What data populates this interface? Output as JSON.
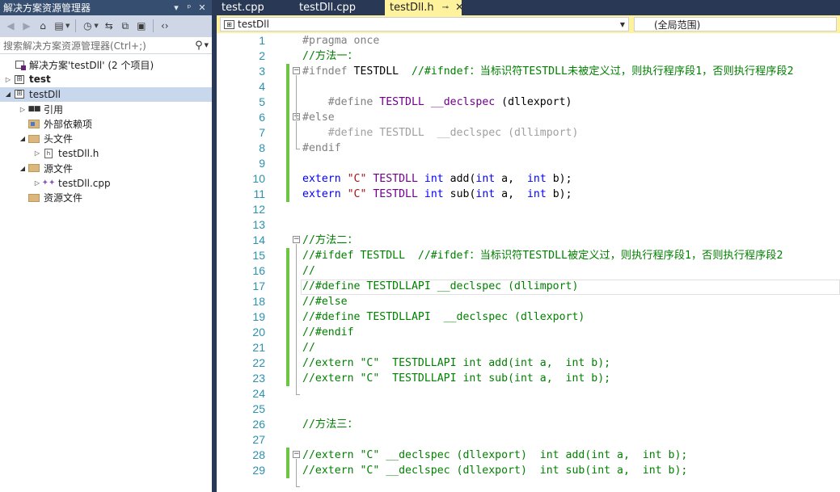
{
  "solution_explorer": {
    "title": "解决方案资源管理器",
    "title_controls": [
      "▾",
      "ᵖ",
      "✕"
    ],
    "search_placeholder": "搜索解决方案资源管理器(Ctrl+;)",
    "tree": [
      {
        "label": "解决方案'testDll' (2 个项目)",
        "icon": "solution-icon",
        "level": 0,
        "expander": "",
        "bold": false,
        "selected": false
      },
      {
        "label": "test",
        "icon": "project-icon",
        "level": 0,
        "expander": "▷",
        "bold": true,
        "selected": false
      },
      {
        "label": "testDll",
        "icon": "project-icon",
        "level": 0,
        "expander": "◢",
        "bold": false,
        "selected": true
      },
      {
        "label": "引用",
        "icon": "references-icon",
        "level": 1,
        "expander": "▷",
        "bold": false,
        "selected": false
      },
      {
        "label": "外部依赖项",
        "icon": "external-dependencies-icon",
        "level": 1,
        "expander": "",
        "bold": false,
        "selected": false
      },
      {
        "label": "头文件",
        "icon": "folder-icon",
        "level": 1,
        "expander": "◢",
        "bold": false,
        "selected": false
      },
      {
        "label": "testDll.h",
        "icon": "header-file-icon",
        "level": 2,
        "expander": "▷",
        "bold": false,
        "selected": false
      },
      {
        "label": "源文件",
        "icon": "folder-icon",
        "level": 1,
        "expander": "◢",
        "bold": false,
        "selected": false
      },
      {
        "label": "testDll.cpp",
        "icon": "cpp-file-icon",
        "level": 2,
        "expander": "▷",
        "bold": false,
        "selected": false
      },
      {
        "label": "资源文件",
        "icon": "folder-icon",
        "level": 1,
        "expander": "",
        "bold": false,
        "selected": false
      }
    ]
  },
  "editor": {
    "tabs": [
      {
        "label": "test.cpp",
        "active": false
      },
      {
        "label": "testDll.cpp",
        "active": false
      },
      {
        "label": "testDll.h",
        "active": true,
        "pin": "⊸",
        "close": "✕"
      }
    ],
    "nav_left": "testDll",
    "nav_right": "(全局范围)",
    "lines": [
      {
        "n": "1",
        "segs": [
          [
            "pp",
            "#pragma once"
          ]
        ]
      },
      {
        "n": "2",
        "segs": [
          [
            "cm",
            "//方法一："
          ]
        ]
      },
      {
        "n": "3",
        "segs": [
          [
            "pp",
            "#ifndef "
          ],
          [
            "pl",
            "TESTDLL  "
          ],
          [
            "cm",
            "//#ifndef：当标识符TESTDLL未被定义过，则执行程序段1，否则执行程序段2"
          ]
        ]
      },
      {
        "n": "4",
        "segs": []
      },
      {
        "n": "5",
        "segs": [
          [
            "pp",
            "    #define "
          ],
          [
            "mac",
            "TESTDLL "
          ],
          [
            "mac",
            "__declspec"
          ],
          [
            "pl",
            " (dllexport)"
          ]
        ]
      },
      {
        "n": "6",
        "segs": [
          [
            "pp",
            "#else"
          ]
        ]
      },
      {
        "n": "7",
        "segs": [
          [
            "dim",
            "    #define TESTDLL  __declspec (dllimport)"
          ]
        ]
      },
      {
        "n": "8",
        "segs": [
          [
            "pp",
            "#endif"
          ]
        ]
      },
      {
        "n": "9",
        "segs": []
      },
      {
        "n": "10",
        "segs": [
          [
            "kw",
            "extern "
          ],
          [
            "str",
            "\"C\" "
          ],
          [
            "mac",
            "TESTDLL "
          ],
          [
            "kw",
            "int "
          ],
          [
            "pl",
            "add("
          ],
          [
            "kw",
            "int "
          ],
          [
            "pl",
            "a,  "
          ],
          [
            "kw",
            "int "
          ],
          [
            "pl",
            "b);"
          ]
        ]
      },
      {
        "n": "11",
        "segs": [
          [
            "kw",
            "extern "
          ],
          [
            "str",
            "\"C\" "
          ],
          [
            "mac",
            "TESTDLL "
          ],
          [
            "kw",
            "int "
          ],
          [
            "pl",
            "sub("
          ],
          [
            "kw",
            "int "
          ],
          [
            "pl",
            "a,  "
          ],
          [
            "kw",
            "int "
          ],
          [
            "pl",
            "b);"
          ]
        ]
      },
      {
        "n": "12",
        "segs": []
      },
      {
        "n": "13",
        "segs": []
      },
      {
        "n": "14",
        "segs": [
          [
            "cm",
            "//方法二："
          ]
        ]
      },
      {
        "n": "15",
        "segs": [
          [
            "cm",
            "//#ifdef TESTDLL  //#ifdef：当标识符TESTDLL被定义过，则执行程序段1，否则执行程序段2"
          ]
        ]
      },
      {
        "n": "16",
        "segs": [
          [
            "cm",
            "//"
          ]
        ]
      },
      {
        "n": "17",
        "segs": [
          [
            "cm",
            "//#define TESTDLLAPI __declspec (dllimport)"
          ]
        ]
      },
      {
        "n": "18",
        "segs": [
          [
            "cm",
            "//#else"
          ]
        ]
      },
      {
        "n": "19",
        "segs": [
          [
            "cm",
            "//#define TESTDLLAPI  __declspec (dllexport)"
          ]
        ]
      },
      {
        "n": "20",
        "segs": [
          [
            "cm",
            "//#endif"
          ]
        ]
      },
      {
        "n": "21",
        "segs": [
          [
            "cm",
            "//"
          ]
        ]
      },
      {
        "n": "22",
        "segs": [
          [
            "cm",
            "//extern \"C\"  TESTDLLAPI int add(int a,  int b);"
          ]
        ]
      },
      {
        "n": "23",
        "segs": [
          [
            "cm",
            "//extern \"C\"  TESTDLLAPI int sub(int a,  int b);"
          ]
        ]
      },
      {
        "n": "24",
        "segs": []
      },
      {
        "n": "25",
        "segs": []
      },
      {
        "n": "26",
        "segs": [
          [
            "cm",
            "//方法三："
          ]
        ]
      },
      {
        "n": "27",
        "segs": []
      },
      {
        "n": "28",
        "segs": [
          [
            "cm",
            "//extern \"C\" __declspec (dllexport)  int add(int a,  int b);"
          ]
        ]
      },
      {
        "n": "29",
        "segs": [
          [
            "cm",
            "//extern \"C\" __declspec (dllexport)  int sub(int a,  int b);"
          ]
        ]
      }
    ],
    "colors": {
      "preprocessor": "#808080",
      "keyword": "#0000ff",
      "comment": "#008000",
      "string": "#a31515",
      "macro": "#6f008a",
      "line_number": "#2b91af",
      "change_bar": "#6cc644",
      "active_tab": "#fff29d"
    }
  }
}
